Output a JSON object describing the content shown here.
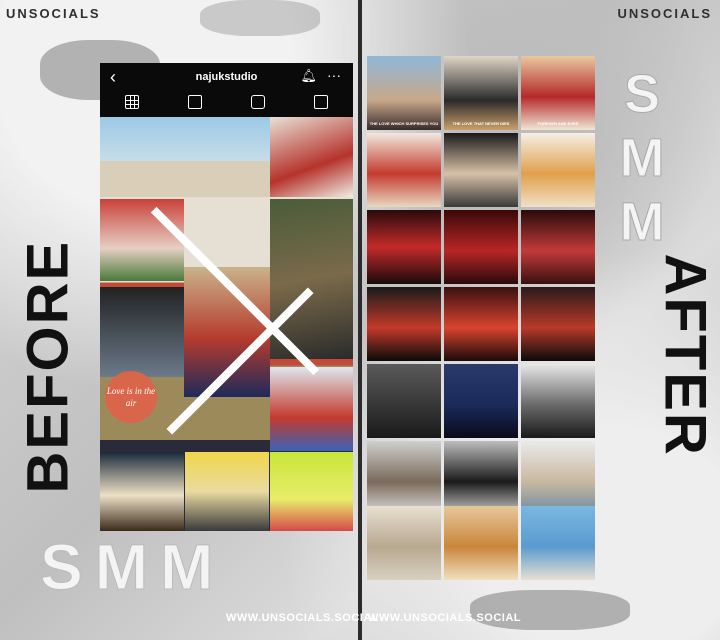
{
  "brand": "UNSOCIALS",
  "labels": {
    "before": "BEFORE",
    "after": "AFTER",
    "smm_h": "SMM",
    "smm_v": [
      "S",
      "M",
      "M"
    ]
  },
  "url": "WWW.UNSOCIALS.SOCIAL",
  "profile": {
    "username": "najukstudio",
    "badge": "Love is in the air"
  },
  "captions": [
    "THE LOVE WHICH SURPRISES YOU",
    "THE LOVE THAT NEVER DIES",
    "FOREVER AND EVER"
  ],
  "colors": {
    "accent": "#d9654a",
    "dark": "#111111",
    "light": "#f4f4f4"
  },
  "icons": {
    "back": "back-arrow-icon",
    "bell": "bell-icon",
    "more": "more-icon",
    "grid": "grid-icon",
    "reels": "reels-icon",
    "tv": "tv-icon",
    "tagged": "tagged-icon"
  }
}
